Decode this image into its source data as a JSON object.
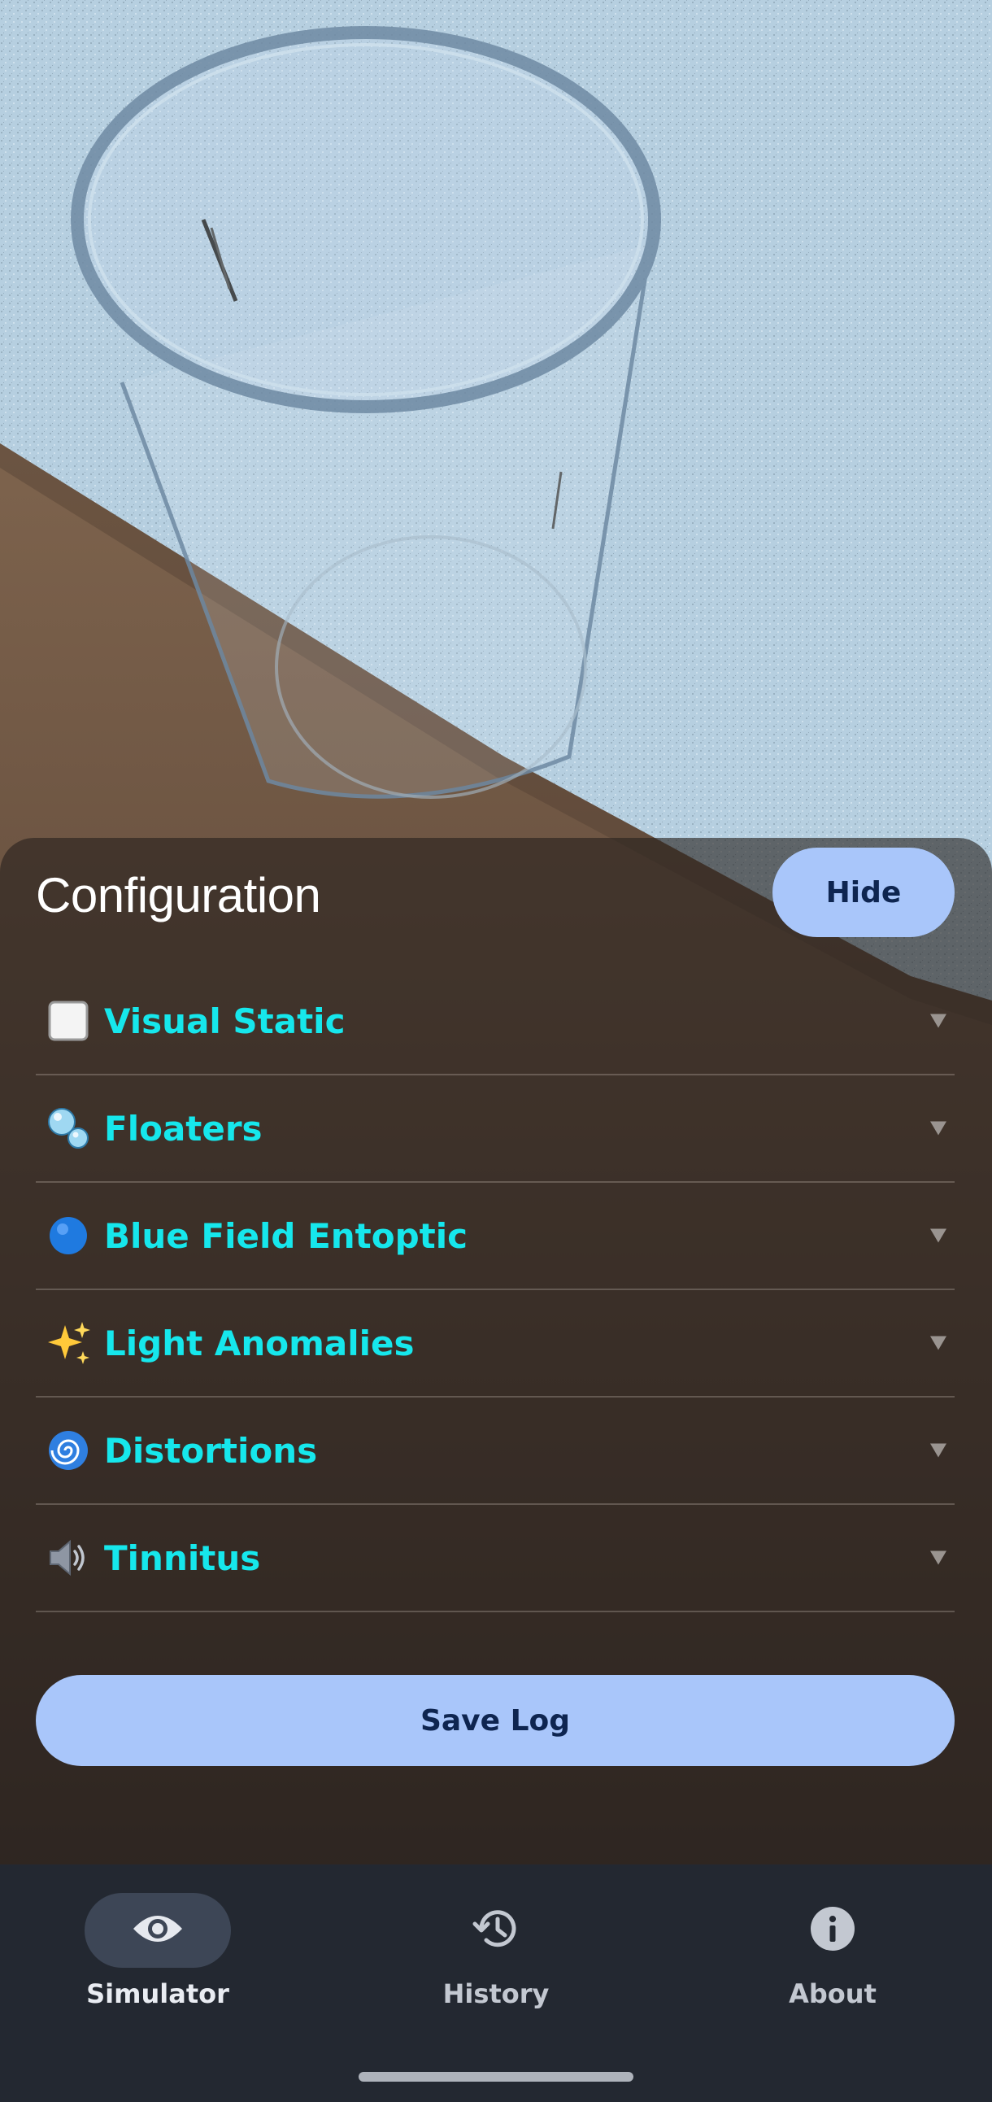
{
  "panel": {
    "title": "Configuration",
    "hide_label": "Hide",
    "sections": [
      {
        "icon": "white-square-icon",
        "label": "Visual Static"
      },
      {
        "icon": "bubbles-icon",
        "label": "Floaters"
      },
      {
        "icon": "blue-circle-icon",
        "label": "Blue Field Entoptic"
      },
      {
        "icon": "sparkles-icon",
        "label": "Light Anomalies"
      },
      {
        "icon": "cyclone-icon",
        "label": "Distortions"
      },
      {
        "icon": "speaker-icon",
        "label": "Tinnitus"
      }
    ],
    "save_label": "Save Log",
    "colors": {
      "section_label": "#16e7ec",
      "button_bg": "#a9c6fa",
      "button_text": "#0e2550"
    }
  },
  "nav": {
    "items": [
      {
        "icon": "eye-icon",
        "label": "Simulator",
        "active": true
      },
      {
        "icon": "history-icon",
        "label": "History",
        "active": false
      },
      {
        "icon": "info-icon",
        "label": "About",
        "active": false
      }
    ],
    "colors": {
      "background": "#232831",
      "active_pill": "#3d4656"
    }
  }
}
